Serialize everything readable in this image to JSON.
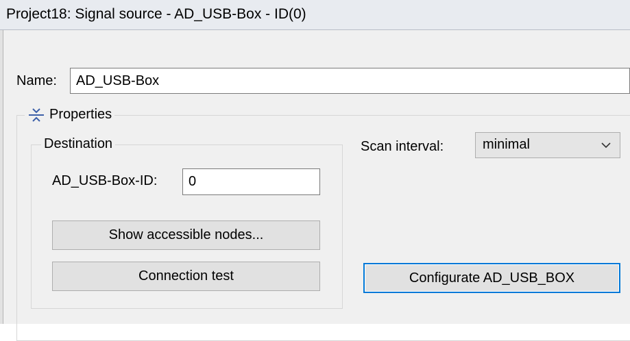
{
  "window": {
    "title": "Project18: Signal source - AD_USB-Box - ID(0)"
  },
  "name_field": {
    "label": "Name:",
    "value": "AD_USB-Box"
  },
  "properties": {
    "label": "Properties",
    "destination": {
      "label": "Destination",
      "box_id_label": "AD_USB-Box-ID:",
      "box_id_value": "0",
      "show_nodes_label": "Show accessible nodes...",
      "connection_test_label": "Connection test"
    },
    "scan_interval": {
      "label": "Scan interval:",
      "selected": "minimal"
    },
    "configurate_label": "Configurate AD_USB_BOX"
  },
  "icons": {
    "collapse": "collapse-icon",
    "dropdown": "chevron-down-icon"
  },
  "colors": {
    "accent": "#0078d7",
    "window_bg": "#f0f0f0"
  }
}
